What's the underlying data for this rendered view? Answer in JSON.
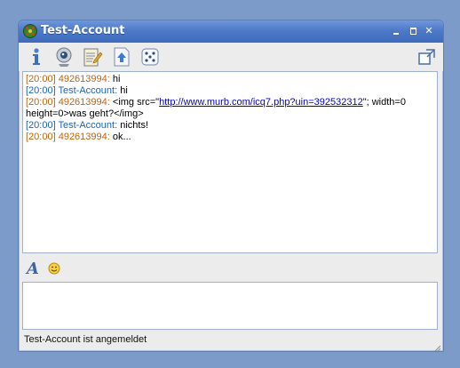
{
  "window": {
    "title": "Test-Account"
  },
  "toolbar": {
    "icons": [
      "info-icon",
      "webcam-icon",
      "notepad-icon",
      "send-file-icon",
      "dice-icon"
    ],
    "detach_icon": "popout-icon"
  },
  "chat": {
    "messages": [
      {
        "time": "[20:00]",
        "sender": "492613994",
        "type": "mine",
        "text_before": "hi",
        "link": "",
        "text_after": ""
      },
      {
        "time": "[20:00]",
        "sender": "Test-Account",
        "type": "theirs",
        "text_before": "hi",
        "link": "",
        "text_after": ""
      },
      {
        "time": "[20:00]",
        "sender": "492613994",
        "type": "mine",
        "text_before": "<img src=\"",
        "link": "http://www.murb.com/icq7.php?uin=392532312",
        "text_after": "\"; width=0 height=0>was geht?</img>"
      },
      {
        "time": "[20:00]",
        "sender": "Test-Account",
        "type": "theirs",
        "text_before": "nichts!",
        "link": "",
        "text_after": ""
      },
      {
        "time": "[20:00]",
        "sender": "492613994",
        "type": "mine",
        "text_before": "ok...",
        "link": "",
        "text_after": ""
      }
    ]
  },
  "format": {
    "font_label": "A",
    "emoticon_icon": "smiley-icon"
  },
  "input": {
    "value": ""
  },
  "status": {
    "text": "Test-Account ist angemeldet"
  },
  "colors": {
    "mine": "#c4620a",
    "theirs": "#1d62b7",
    "titlebar": "#4d79c8",
    "link": "#0000d8"
  }
}
